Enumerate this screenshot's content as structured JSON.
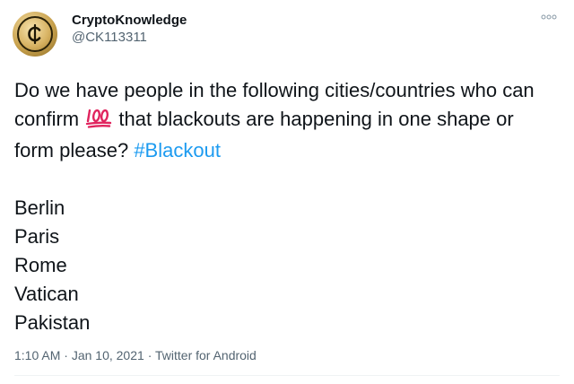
{
  "author": {
    "display_name": "CryptoKnowledge",
    "handle": "@CK113311"
  },
  "tweet": {
    "text_part1": "Do we have people in the following cities/countries who can confirm",
    "emoji": "hundred-points-emoji",
    "text_part2": "that blackouts are happening in one shape or form please?",
    "hashtag": "#Blackout",
    "cities": [
      "Berlin",
      "Paris",
      "Rome",
      "Vatican",
      "Pakistan"
    ]
  },
  "meta": {
    "time": "1:10 AM",
    "date": "Jan 10, 2021",
    "source": "Twitter for Android",
    "separator": "·"
  },
  "icons": {
    "avatar": "gold-coin-cent-icon",
    "more": "more-options-icon"
  },
  "colors": {
    "link": "#1d9bf0",
    "text": "#0f1419",
    "secondary": "#536471",
    "emoji": "#e0245e",
    "avatar_gold": "#c9a24e"
  }
}
